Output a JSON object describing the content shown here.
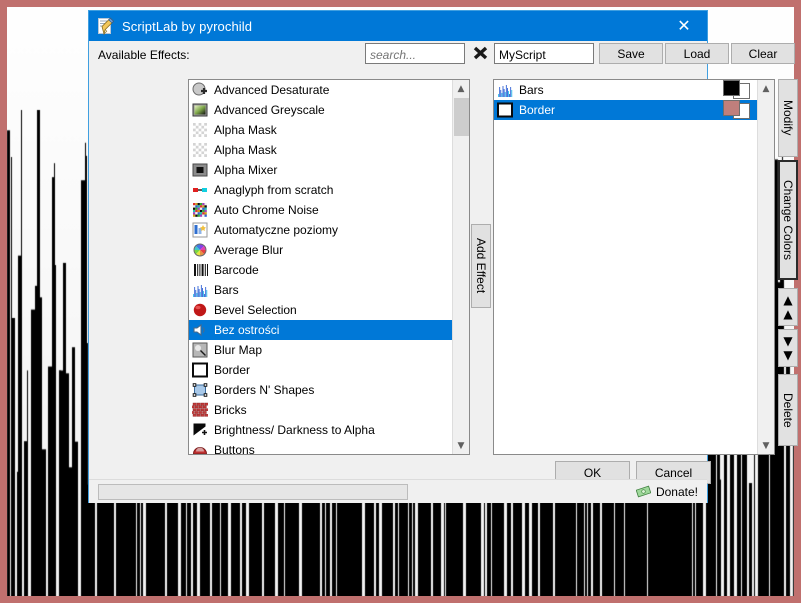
{
  "window": {
    "title": "ScriptLab by pyrochild",
    "icon": "script-pencil-icon",
    "close_label": "✕",
    "titlebar_color": "#0078d7"
  },
  "toolbar": {
    "available_label": "Available Effects:",
    "search_placeholder": "search...",
    "search_value": "",
    "clear_search_icon": "x-clear-icon",
    "script_name_value": "MyScript",
    "save_label": "Save",
    "load_label": "Load",
    "clear_label": "Clear"
  },
  "effects_list": {
    "selected_index": 12,
    "items": [
      {
        "label": "Advanced Desaturate",
        "icon": "desaturate-icon"
      },
      {
        "label": "Advanced Greyscale",
        "icon": "greyscale-icon"
      },
      {
        "label": "Alpha Mask",
        "icon": "checker-icon"
      },
      {
        "label": "Alpha Mask",
        "icon": "checker-icon"
      },
      {
        "label": "Alpha Mixer",
        "icon": "alpha-mixer-icon"
      },
      {
        "label": "Anaglyph from scratch",
        "icon": "anaglyph-icon"
      },
      {
        "label": "Auto Chrome Noise",
        "icon": "noise-icon"
      },
      {
        "label": "Automatyczne poziomy",
        "icon": "levels-icon"
      },
      {
        "label": "Average Blur",
        "icon": "color-wheel-icon"
      },
      {
        "label": "Barcode",
        "icon": "barcode-icon"
      },
      {
        "label": "Bars",
        "icon": "bars-icon"
      },
      {
        "label": "Bevel Selection",
        "icon": "red-sphere-icon"
      },
      {
        "label": "Bez ostrości",
        "icon": "speaker-icon"
      },
      {
        "label": "Blur Map",
        "icon": "blur-map-icon"
      },
      {
        "label": "Border",
        "icon": "border-icon"
      },
      {
        "label": "Borders N' Shapes",
        "icon": "shapes-icon"
      },
      {
        "label": "Bricks",
        "icon": "bricks-icon"
      },
      {
        "label": "Brightness/ Darkness to Alpha",
        "icon": "brightness-alpha-icon"
      },
      {
        "label": "Buttons",
        "icon": "buttons-icon"
      }
    ]
  },
  "script_list": {
    "selected_index": 1,
    "items": [
      {
        "label": "Bars",
        "icon": "bars-icon",
        "color_front": "#000000",
        "color_back": "#ffffff"
      },
      {
        "label": "Border",
        "icon": "border-icon",
        "color_front": "#c07f7c",
        "color_back": "#ffffff"
      }
    ]
  },
  "side_buttons": {
    "add_effect_label": "Add Effect",
    "modify_label": "Modify",
    "change_colors_label": "Change Colors",
    "move_up_icon": "double-chevron-up-icon",
    "move_down_icon": "double-chevron-down-icon",
    "delete_label": "Delete"
  },
  "footer": {
    "ok_label": "OK",
    "cancel_label": "Cancel",
    "progress_value": 0,
    "donate_label": "Donate!",
    "donate_icon": "money-bill-icon"
  },
  "background": {
    "description": "Bars effect preview over white canvas",
    "frame_color": "#c0706e",
    "bar_color": "#000000"
  }
}
